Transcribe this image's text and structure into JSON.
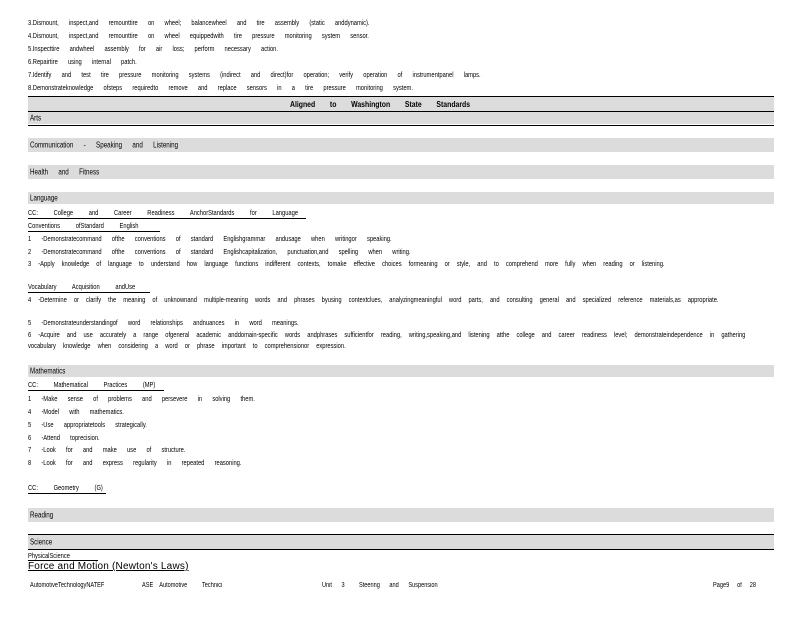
{
  "tasks": [
    "3.Dismount, inspect,and remounttire on wheel; balancewheel and tire assembly (static anddynamic).",
    "4.Dismount, inspect,and remounttire on wheel equippedwith tire pressure monitoring system sensor.",
    "5.Inspecttire andwheel assembly for air loss; perform necessary action.",
    "6.Repairtire using internal patch.",
    "7.Identify and test tire pressure monitoring systems (indirect and direct)for operation; verify operation of instrumentpanel lamps.",
    "8.Demonstrateknowledge ofsteps requiredto remove and replace sensors in a tire pressure monitoring system."
  ],
  "aligned_heading": "Aligned to Washington State Standards",
  "sections": {
    "arts": "Arts",
    "communication": "Communication - Speaking and Listening",
    "health": "Health and Fitness",
    "language": "Language",
    "mathematics": "Mathematics",
    "reading": "Reading",
    "science": "Science"
  },
  "language": {
    "cc_heading": "CC: College and Career Readiness AnchorStandards for Language",
    "conventions_heading": "Conventions ofStandard English",
    "conv_items": [
      "1 -Demonstratecommand ofthe conventions of standard Englishgrammar andusage when writingor speaking.",
      "2 -Demonstratecommand ofthe conventions of standard Englishcapitalization, punctuation,and spelling when writing.",
      "3 -Apply knowledge of language to understand how language functions indifferent contexts, tomake effective choices formeaning or style, and to comprehend more fully when reading or listening."
    ],
    "vocab_heading": "Vocabulary Acquisition andUse",
    "vocab_items": [
      "4 -Determine or clarify the meaning of unknownand multiple-meaning words and phrases byusing contextclues, analyzingmeaningful word parts, and consulting general and specialized reference materials,as appropriate.",
      "5 -Demonstrateunderstandingof word relationships andnuances in word meanings.",
      "6 -Acquire and use accurately a range ofgeneral academic anddomain-specific words andphrases sufficientfor reading, writing,speaking,and listening atthe college and career readiness level; demonstrateindependence in gathering vocabulary knowledge when considering a word or phrase important to comprehensionor expression."
    ]
  },
  "math": {
    "cc_heading": "CC: Mathematical Practices (MP)",
    "items": [
      "1 -Make sense of problems and persevere in solving them.",
      "4 -Model with mathematics.",
      "5 -Use appropriatetools strategically.",
      "6 -Attend toprecision.",
      "7 -Look for and make use of structure.",
      "8 -Look for and express regularity in repeated reasoning."
    ],
    "geometry_heading": "CC: Geometry (G)"
  },
  "science": {
    "sub_heading": "PhysicalScience",
    "topic": "Force and Motion (Newton's Laws)"
  },
  "footer": {
    "course": "AutomotiveTechnologyNATEF",
    "ase": "ASE Automotive",
    "technician": "Technici",
    "unit": "Unit 3",
    "unit_title": "Steering and Suspension",
    "page_word": "Page9 of 28"
  }
}
